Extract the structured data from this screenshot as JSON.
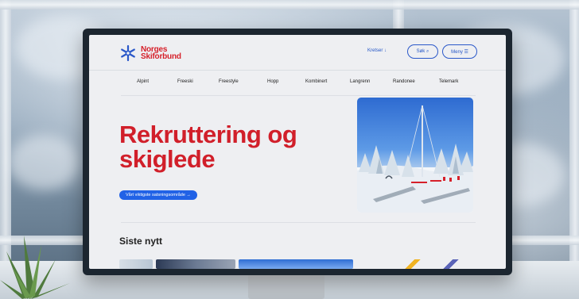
{
  "site": {
    "logo_line1": "Norges",
    "logo_line2": "Skiforbund",
    "brand_color": "#d6202a",
    "accent_color": "#2456c7"
  },
  "header": {
    "kretser_label": "Kretser ↓",
    "search_label": "Søk ⌕",
    "menu_label": "Meny ☰"
  },
  "nav": {
    "items": [
      "Alpint",
      "Freeski",
      "Freestyle",
      "Hopp",
      "Kombinert",
      "Langrenn",
      "Randonee",
      "Telemark"
    ]
  },
  "hero": {
    "title_line1": "Rekruttering og",
    "title_line2": "skiglede",
    "cta_label": "Vårt viktigste satsningsområde →",
    "image_icon": "ski-slope-image"
  },
  "news": {
    "heading": "Siste nytt"
  }
}
